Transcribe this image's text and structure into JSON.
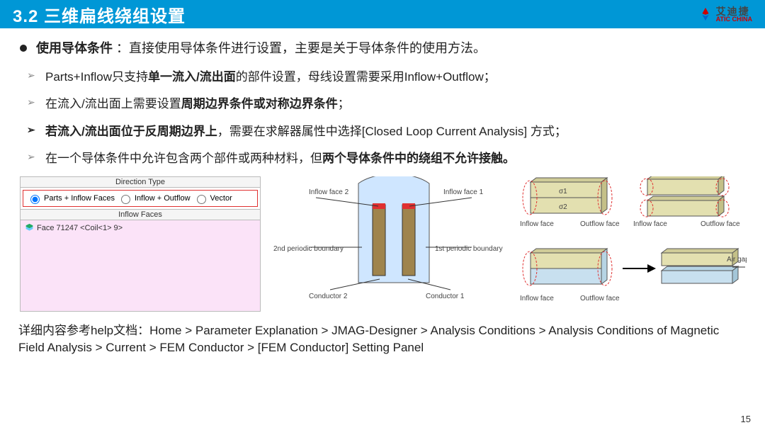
{
  "header": {
    "title": "3.2 三维扁线绕组设置",
    "logo_cn": "艾迪捷",
    "logo_en": "ATIC CHINA"
  },
  "lead": {
    "label": "使用导体条件",
    "text": "：直接使用导体条件进行设置，主要是关于导体条件的使用方法。"
  },
  "bullets": [
    {
      "pre": "Parts+Inflow只支持",
      "b": "单一流入/流出面",
      "post": "的部件设置，母线设置需要采用Inflow+Outflow；",
      "em": false
    },
    {
      "pre": "在流入/流出面上需要设置",
      "b": "周期边界条件或对称边界条件",
      "post": "；",
      "em": false
    },
    {
      "pre": "",
      "b": "若流入/流出面位于反周期边界上",
      "post": "，需要在求解器属性中选择[Closed Loop Current Analysis] 方式；",
      "em": true
    },
    {
      "pre": "在一个导体条件中允许包含两个部件或两种材料，但",
      "b": "两个导体条件中的绕组不允许接触。",
      "post": "",
      "em": false
    }
  ],
  "panel": {
    "group1_title": "Direction Type",
    "r1": "Parts + Inflow Faces",
    "r2": "Inflow + Outflow",
    "r3": "Vector",
    "group2_title": "Inflow Faces",
    "face_item": "Face 71247 <Coil<1> 9>"
  },
  "diag_center": {
    "inflow2": "Inflow face 2",
    "inflow1": "Inflow face 1",
    "pb2": "2nd periodic boundary",
    "pb1": "1st periodic boundary",
    "cond2": "Conductor 2",
    "cond1": "Conductor 1"
  },
  "diag_right": {
    "sigma1": "σ1",
    "sigma2": "σ2",
    "inflow": "Inflow face",
    "outflow": "Outflow face",
    "airgap": "Air gap"
  },
  "footnote": "详细内容参考help文档：Home > Parameter Explanation > JMAG-Designer > Analysis Conditions > Analysis Conditions of Magnetic Field Analysis > Current > FEM Conductor > [FEM Conductor] Setting Panel",
  "page": "15"
}
